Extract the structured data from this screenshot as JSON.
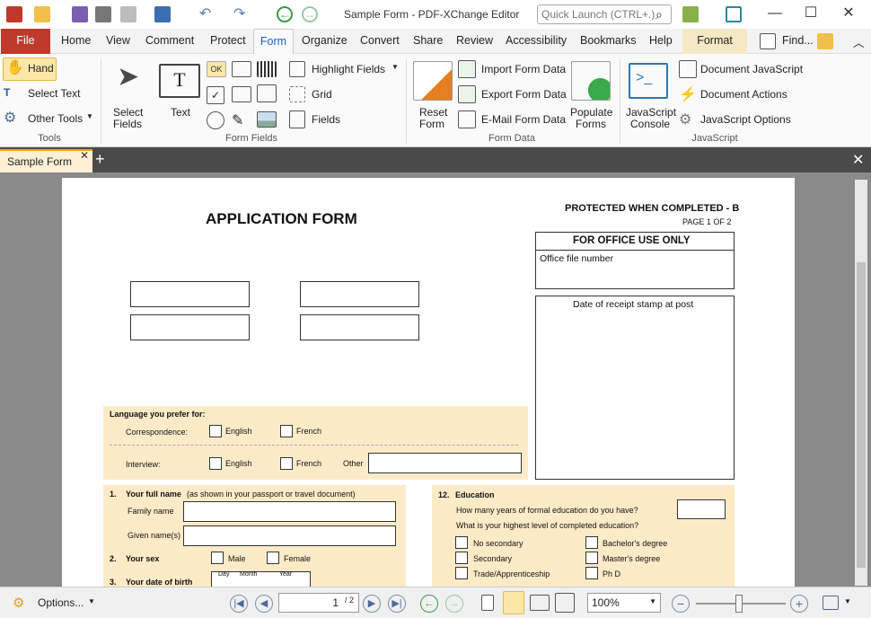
{
  "app": {
    "title": "Sample Form - PDF-XChange Editor",
    "quick_launch_placeholder": "Quick Launch (CTRL+.)"
  },
  "menu": {
    "file": "File",
    "items": [
      "Home",
      "View",
      "Comment",
      "Protect"
    ],
    "active": "Form",
    "items2": [
      "Organize",
      "Convert",
      "Share",
      "Review",
      "Accessibility",
      "Bookmarks",
      "Help"
    ],
    "format": "Format",
    "find": "Find..."
  },
  "ribbon": {
    "tools": {
      "hand": "Hand",
      "select_text": "Select Text",
      "other_tools": "Other Tools",
      "group": "Tools"
    },
    "select_fields": {
      "line1": "Select",
      "line2": "Fields"
    },
    "text": "Text",
    "form_fields_group": "Form Fields",
    "highlight_fields": "Highlight Fields",
    "grid": "Grid",
    "fields": "Fields",
    "reset_form": {
      "line1": "Reset",
      "line2": "Form"
    },
    "import_form_data": "Import Form Data",
    "export_form_data": "Export Form Data",
    "email_form_data": "E-Mail Form Data",
    "populate_forms": {
      "line1": "Populate",
      "line2": "Forms"
    },
    "form_data_group": "Form Data",
    "js_console": {
      "line1": "JavaScript",
      "line2": "Console"
    },
    "document_javascript": "Document JavaScript",
    "document_actions": "Document Actions",
    "javascript_options": "JavaScript Options",
    "javascript_group": "JavaScript",
    "ok_label": "OK"
  },
  "doc_tab": {
    "label": "Sample Form"
  },
  "page": {
    "title": "APPLICATION FORM",
    "protected": "PROTECTED WHEN COMPLETED - B",
    "page_of": "PAGE 1 OF 2",
    "office_use": "FOR OFFICE USE ONLY",
    "office_file_number": "Office file number",
    "date_receipt": "Date of receipt stamp at post",
    "language_prefer": "Language you prefer for:",
    "correspondence": "Correspondence:",
    "interview": "Interview:",
    "english": "English",
    "french": "French",
    "other": "Other",
    "q1_num": "1.",
    "q1_title": "Your full name",
    "q1_sub": "(as shown in your passport or travel document)",
    "family_name": "Family name",
    "given_names": "Given name(s)",
    "q2_num": "2.",
    "q2_title": "Your sex",
    "male": "Male",
    "female": "Female",
    "q3_num": "3.",
    "q3_title": "Your date of birth",
    "day": "Day",
    "month": "Month",
    "year": "Year",
    "q12_num": "12.",
    "q12_title": "Education",
    "years_education": "How many years of formal education do you have?",
    "highest_level": "What is your highest level of completed education?",
    "no_secondary": "No secondary",
    "secondary": "Secondary",
    "trade": "Trade/Apprenticeship",
    "bachelors": "Bachelor's degree",
    "masters": "Master's degree",
    "phd": "Ph D"
  },
  "status": {
    "options": "Options...",
    "page_input": "1",
    "page_total": "/ 2",
    "zoom": "100%"
  }
}
